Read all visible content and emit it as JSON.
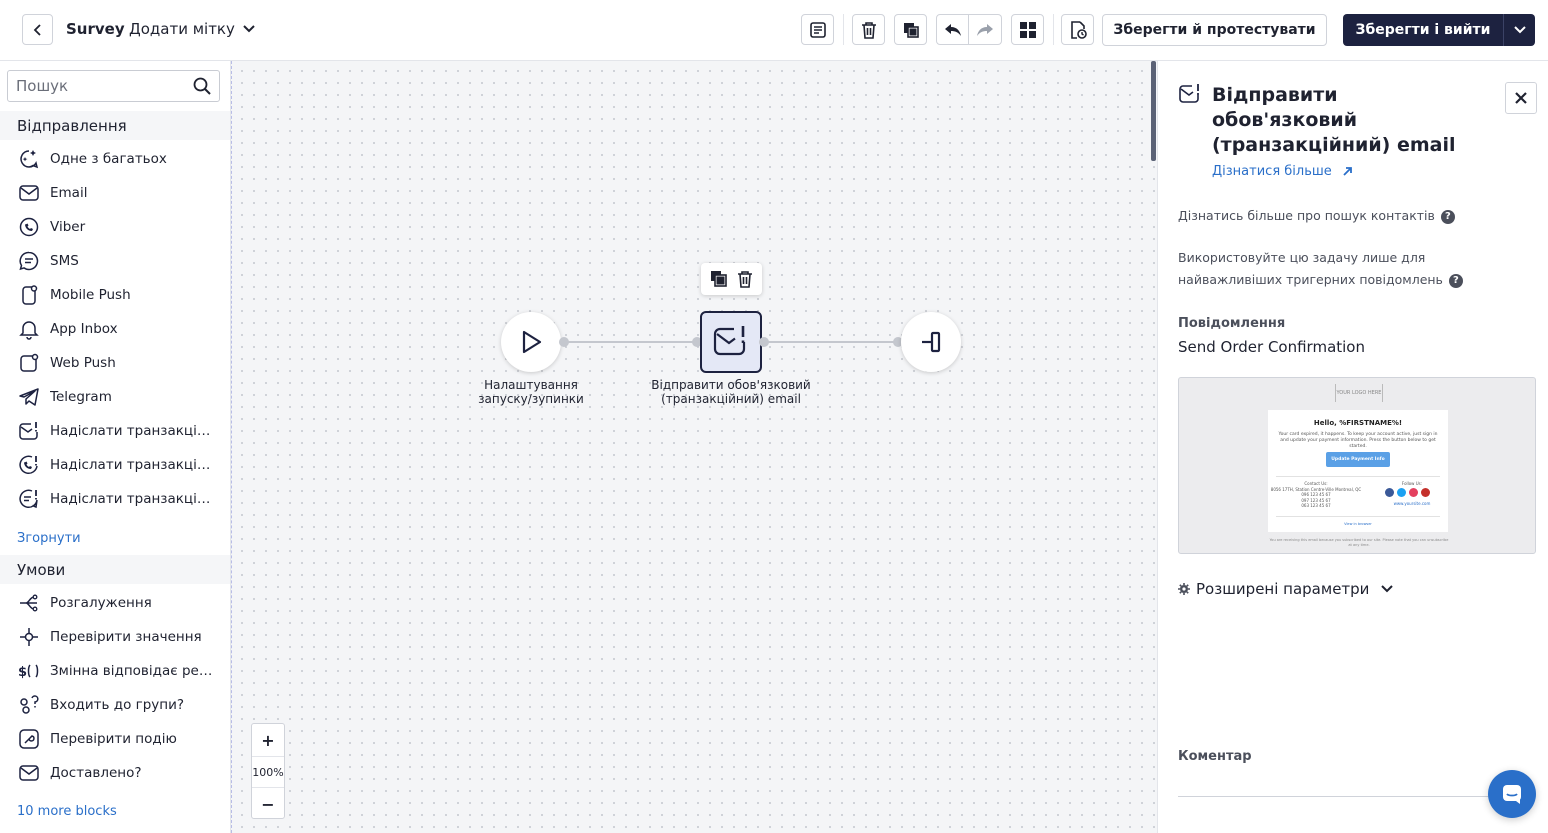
{
  "topbar": {
    "title": "Survey",
    "tag_label": "Додати мітку",
    "save_test_label": "Зберегти й протестувати",
    "save_exit_label": "Зберегти і вийти"
  },
  "sidebar": {
    "search_placeholder": "Пошук",
    "sending": {
      "title": "Відправлення",
      "items": [
        {
          "label": "Одне з багатьох",
          "icon": "sparkle-chat-icon"
        },
        {
          "label": "Email",
          "icon": "envelope-icon"
        },
        {
          "label": "Viber",
          "icon": "viber-icon"
        },
        {
          "label": "SMS",
          "icon": "sms-icon"
        },
        {
          "label": "Mobile Push",
          "icon": "mobile-push-icon"
        },
        {
          "label": "App Inbox",
          "icon": "bell-icon"
        },
        {
          "label": "Web Push",
          "icon": "web-push-icon"
        },
        {
          "label": "Telegram",
          "icon": "telegram-icon"
        },
        {
          "label": "Надіслати транзакційн...",
          "icon": "transactional-email-icon"
        },
        {
          "label": "Надіслати транзакційн...",
          "icon": "transactional-viber-icon"
        },
        {
          "label": "Надіслати транзакційн...",
          "icon": "transactional-sms-icon"
        }
      ],
      "collapse_label": "Згорнути"
    },
    "conditions": {
      "title": "Умови",
      "items": [
        {
          "label": "Розгалуження",
          "icon": "branch-icon"
        },
        {
          "label": "Перевірити значення",
          "icon": "check-value-icon"
        },
        {
          "label": "Змінна відповідає регу...",
          "icon": "regex-icon"
        },
        {
          "label": "Входить до групи?",
          "icon": "group-icon"
        },
        {
          "label": "Перевірити подію",
          "icon": "event-icon"
        },
        {
          "label": "Доставлено?",
          "icon": "delivered-icon"
        }
      ],
      "more_label": "10 more blocks"
    }
  },
  "canvas": {
    "start_label_line1": "Налаштування",
    "start_label_line2": "запуску/зупинки",
    "email_label_line1": "Відправити обов'язковий",
    "email_label_line2": "(транзакційний) email",
    "zoom_level": "100%",
    "zoom_in": "+",
    "zoom_out": "−"
  },
  "panel": {
    "title": "Відправити обов'язковий (транзакційний) email",
    "learn_more": "Дізнатися більше",
    "contact_search_help": "Дізнатись більше про пошук контактів",
    "usage_hint": "Використовуйте цю задачу лише для найважливіших тригерних повідомлень",
    "message_label": "Повідомлення",
    "message_value": "Send Order Confirmation",
    "advanced_label": "Розширені параметри",
    "comment_label": "Коментар",
    "preview": {
      "logo": "YOUR LOGO HERE",
      "hello": "Hello, %FIRSTNAME%!",
      "body": "Your card expired, it happens. To keep your account active, just sign in and update your payment information. Press the button below to get started.",
      "button": "Update Payment Info",
      "contact_title": "Contact Us:",
      "contact_address": "8056 17TH, Station Centre-Ville Montreal, QC",
      "phone1": "096 123 45 67",
      "phone2": "097 123 45 67",
      "phone3": "063 123 45 67",
      "follow_title": "Follow Us:",
      "site": "www.yoursite.com",
      "view_browser": "View in browser",
      "footer": "You are receiving this email because you subscribed to our site. Please note that you can unsubscribe at any time."
    }
  },
  "colors": {
    "primary_dark": "#1d2240",
    "link": "#2a6fc9",
    "canvas_bg": "#f4f5f7"
  }
}
